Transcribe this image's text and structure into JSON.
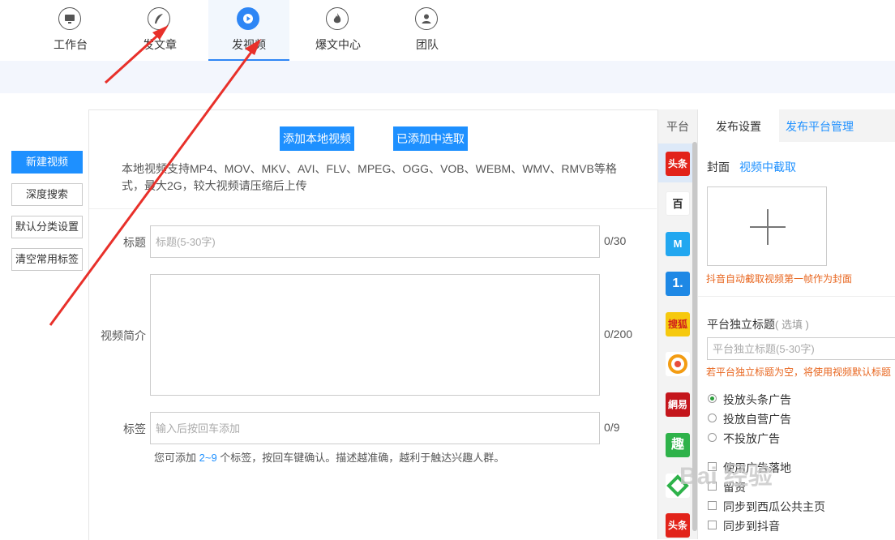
{
  "nav": {
    "items": [
      {
        "label": "工作台",
        "icon": "monitor-icon"
      },
      {
        "label": "发文章",
        "icon": "feather-icon"
      },
      {
        "label": "发视频",
        "icon": "play-icon",
        "active": true
      },
      {
        "label": "爆文中心",
        "icon": "flame-icon"
      },
      {
        "label": "团队",
        "icon": "user-icon"
      }
    ]
  },
  "sidebar": {
    "buttons": [
      "新建视频",
      "深度搜索",
      "默认分类设置",
      "清空常用标签"
    ]
  },
  "upload": {
    "add_local": "添加本地视频",
    "choose_added": "已添加中选取",
    "desc_line1": "本地视频支持MP4、MOV、MKV、AVI、FLV、MPEG、OGG、VOB、WEBM、WMV、RMVB等格",
    "desc_line2": "式，最大2G，较大视频请压缩后上传"
  },
  "form": {
    "title_label": "标题",
    "title_placeholder": "标题(5-30字)",
    "title_count": "0/30",
    "intro_label": "视频简介",
    "intro_count": "0/200",
    "tags_label": "标签",
    "tags_placeholder": "输入后按回车添加",
    "tags_count": "0/9",
    "tags_hint_pre": "您可添加 ",
    "tags_hint_range": "2~9",
    "tags_hint_post": " 个标签，按回车键确认。描述越准确，越利于触达兴趣人群。"
  },
  "platforms": {
    "header": "平台",
    "items": [
      {
        "text": "头条",
        "color": "#e2231a"
      },
      {
        "text": "百",
        "color": "#ffffff"
      },
      {
        "text": "M",
        "color": "#22a7f0"
      },
      {
        "text": "1.",
        "color": "#1e88e5"
      },
      {
        "text": "搜狐",
        "color": "#f6c90e"
      },
      {
        "text": "",
        "color": "#ffffff"
      },
      {
        "text": "網易",
        "color": "#c4161c"
      },
      {
        "text": "趣",
        "color": "#2eb24a"
      },
      {
        "text": "",
        "color": "#ffffff"
      },
      {
        "text": "头条",
        "color": "#e2231a"
      }
    ]
  },
  "settings": {
    "tab_publish": "发布设置",
    "tab_manage": "发布平台管理",
    "cover_label": "封面",
    "cover_link": "视频中截取",
    "cover_note": "抖音自动截取视频第一帧作为封面",
    "indep_title_label": "平台独立标题",
    "indep_title_optional": "( 选填 )",
    "indep_title_placeholder": "平台独立标题(5-30字)",
    "indep_title_note": "若平台独立标题为空，将使用视频默认标题",
    "ad_options": [
      "投放头条广告",
      "投放自营广告",
      "不投放广告"
    ],
    "ad_selected": 0,
    "checkbox_options": [
      "使用广告落地",
      "留资",
      "同步到西瓜公共主页",
      "同步到抖音"
    ]
  },
  "watermark": "Bai 经验",
  "colors": {
    "accent": "#1e90ff",
    "arrow": "#e8302a",
    "warning": "#e8661f"
  }
}
